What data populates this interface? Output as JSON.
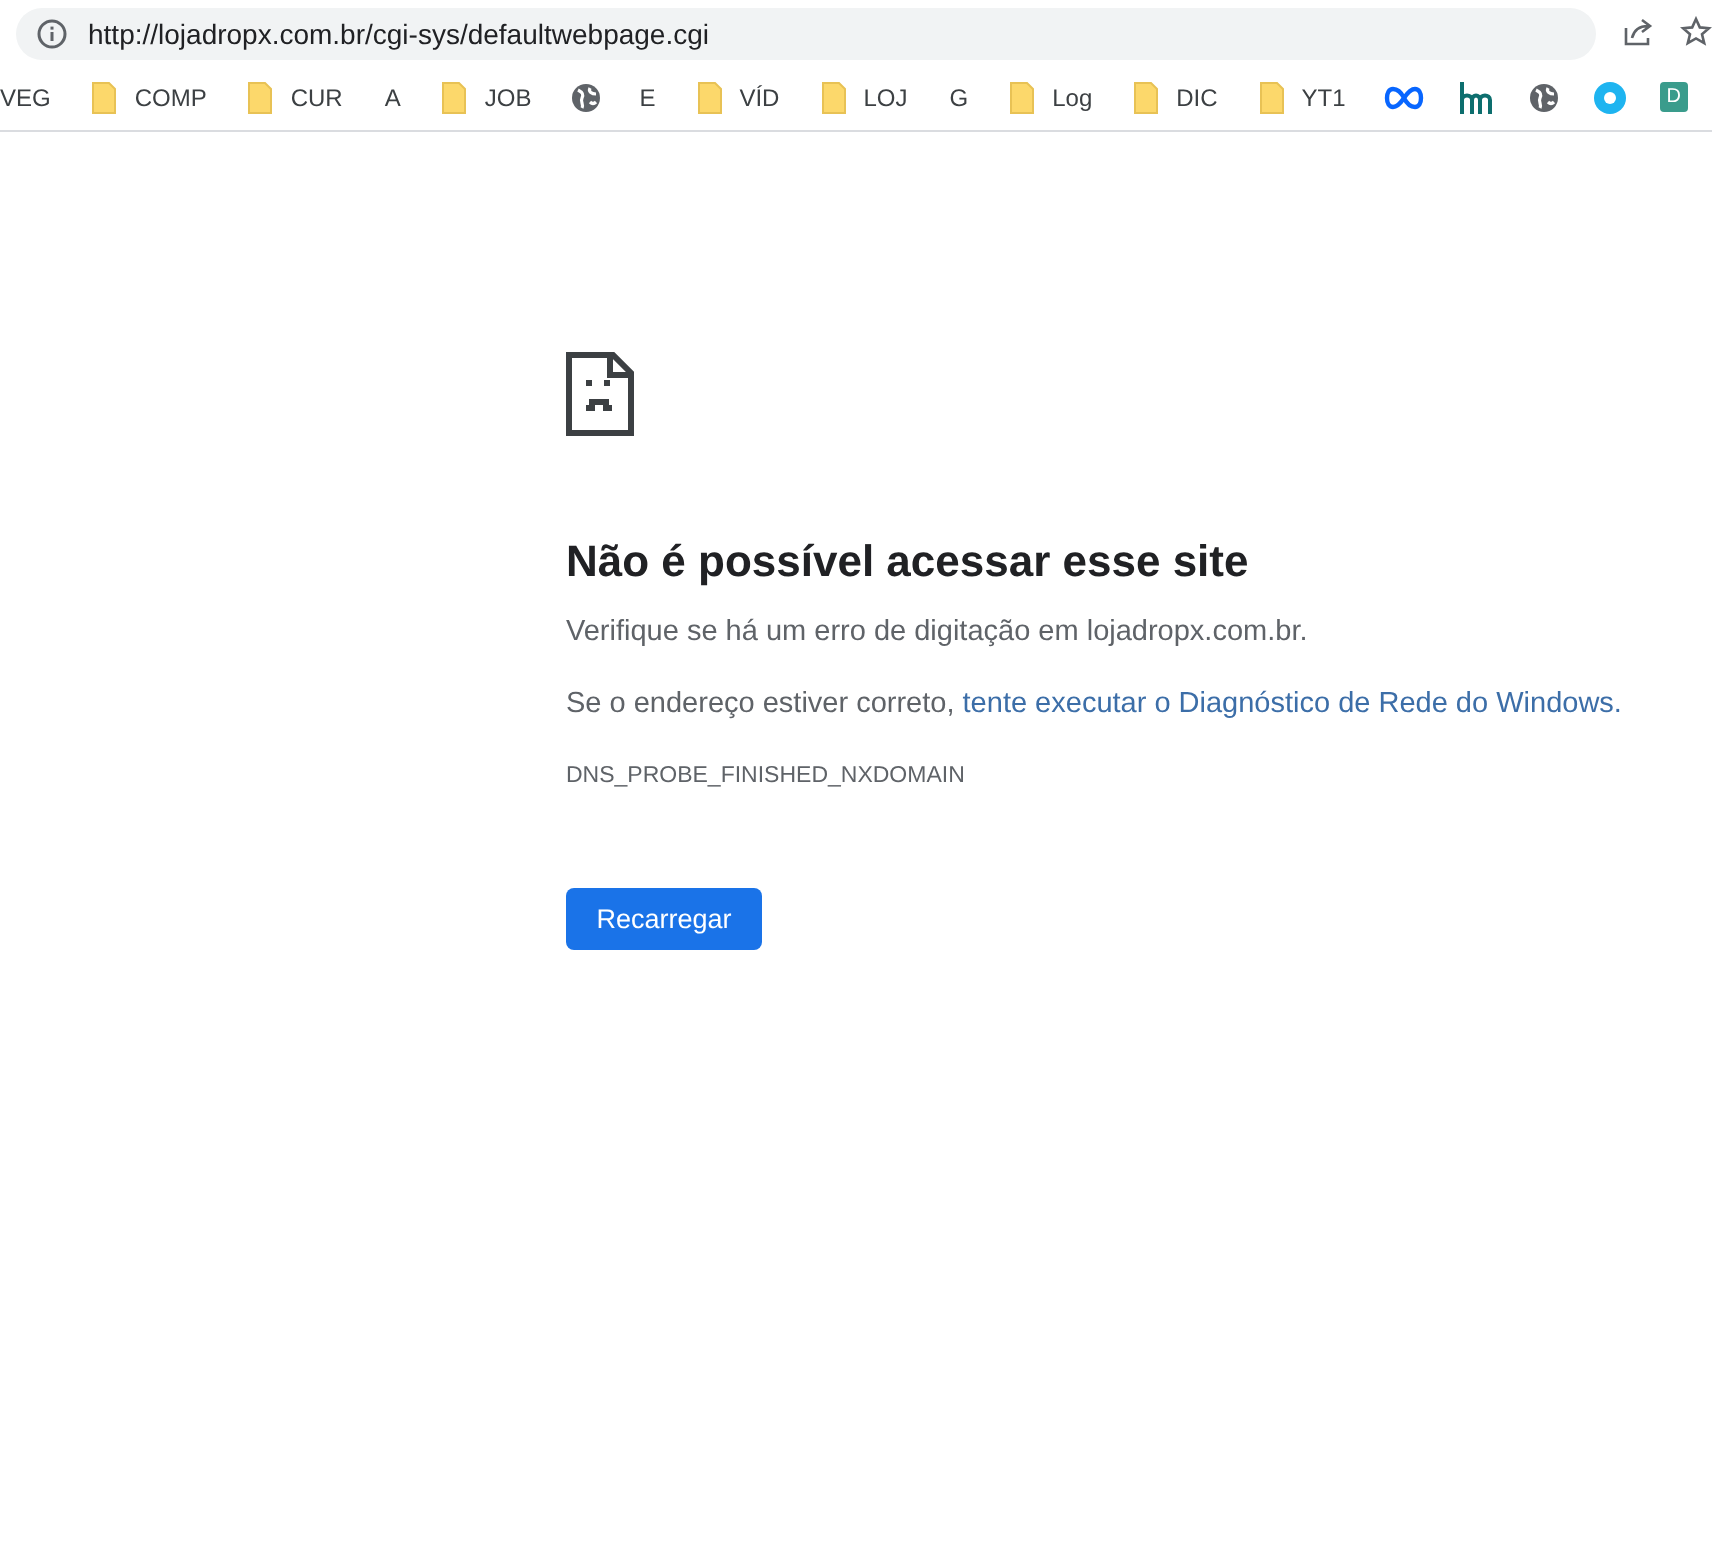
{
  "address_bar": {
    "url": "http://lojadropx.com.br/cgi-sys/defaultwebpage.cgi"
  },
  "bookmarks": [
    {
      "kind": "text",
      "label": "VEG"
    },
    {
      "kind": "folder",
      "label": "COMP"
    },
    {
      "kind": "folder",
      "label": "CUR"
    },
    {
      "kind": "text",
      "label": "A"
    },
    {
      "kind": "folder",
      "label": "JOB"
    },
    {
      "kind": "globe"
    },
    {
      "kind": "text",
      "label": "E"
    },
    {
      "kind": "folder",
      "label": "VÍD"
    },
    {
      "kind": "folder",
      "label": "LOJ"
    },
    {
      "kind": "text",
      "label": "G"
    },
    {
      "kind": "folder",
      "label": "Log"
    },
    {
      "kind": "folder",
      "label": "DIC"
    },
    {
      "kind": "folder",
      "label": "YT1"
    },
    {
      "kind": "infinity"
    },
    {
      "kind": "hm"
    },
    {
      "kind": "globe"
    },
    {
      "kind": "ring"
    },
    {
      "kind": "letter",
      "label": "D"
    }
  ],
  "error": {
    "title": "Não é possível acessar esse site",
    "message": "Verifique se há um erro de digitação em lojadropx.com.br.",
    "hint": "Se o endereço estiver correto,",
    "hint_link": "tente executar o Diagnóstico de Rede do Windows.",
    "code": "DNS_PROBE_FINISHED_NXDOMAIN",
    "button": "Recarregar"
  }
}
